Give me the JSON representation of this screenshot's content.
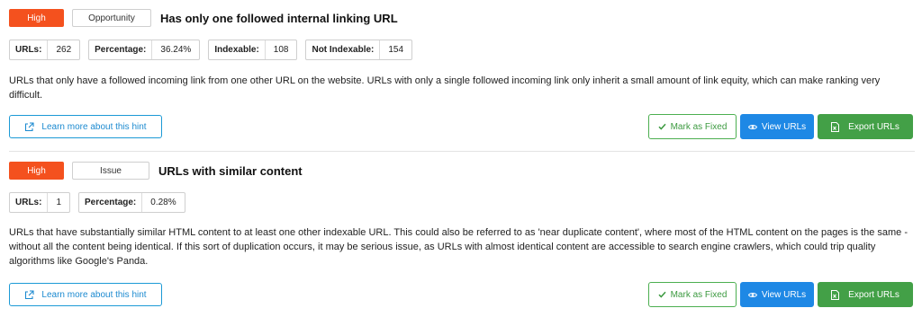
{
  "hints": [
    {
      "priority": "High",
      "type": "Opportunity",
      "title": "Has only one followed internal linking URL",
      "stats": [
        {
          "label": "URLs:",
          "value": "262"
        },
        {
          "label": "Percentage:",
          "value": "36.24%"
        },
        {
          "label": "Indexable:",
          "value": "108"
        },
        {
          "label": "Not Indexable:",
          "value": "154"
        }
      ],
      "description": "URLs that only have a followed incoming link from one other URL on the website. URLs with only a single followed incoming link only inherit a small amount of link equity, which can make ranking very difficult.",
      "learn_label": "Learn more about this hint",
      "mark_fixed_label": "Mark as Fixed",
      "view_label": "View URLs",
      "export_label": "Export URLs"
    },
    {
      "priority": "High",
      "type": "Issue",
      "title": "URLs with similar content",
      "stats": [
        {
          "label": "URLs:",
          "value": "1"
        },
        {
          "label": "Percentage:",
          "value": "0.28%"
        }
      ],
      "description": "URLs that have substantially similar HTML content to at least one other indexable URL. This could also be referred to as 'near duplicate content', where most of the HTML content on the pages is the same - without all the content being identical. If this sort of duplication occurs, it may be serious issue, as URLs with almost identical content are accessible to search engine crawlers, which could trip quality algorithms like Google's Panda.",
      "learn_label": "Learn more about this hint",
      "mark_fixed_label": "Mark as Fixed",
      "view_label": "View URLs",
      "export_label": "Export URLs"
    }
  ],
  "colors": {
    "priority_high": "#f4511e",
    "link_blue": "#1c8ad0",
    "view_blue": "#1e88e5",
    "export_green": "#43a047",
    "fixed_green": "#4caf50"
  },
  "icons": {
    "learn": "external-link-icon",
    "fixed": "checkmark-icon",
    "view": "eye-icon",
    "export": "spreadsheet-icon"
  }
}
